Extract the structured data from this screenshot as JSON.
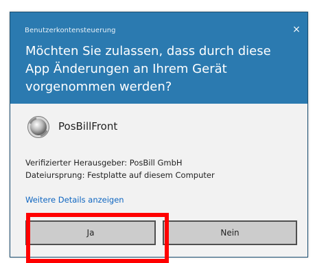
{
  "dialog": {
    "title": "Benutzerkontensteuerung",
    "close_label": "×",
    "question": "Möchten Sie zulassen, dass durch diese App Änderungen an Ihrem Gerät vorgenommen werden?",
    "app_name": "PosBillFront",
    "app_icon": "posbill-logo-icon",
    "publisher_line": "Verifizierter Herausgeber: PosBill GmbH",
    "origin_line": "Dateiursprung: Festplatte auf diesem Computer",
    "details_link": "Weitere Details anzeigen",
    "buttons": {
      "yes": "Ja",
      "no": "Nein"
    }
  },
  "colors": {
    "header_bg": "#2b7ab0",
    "body_bg": "#f2f2f2",
    "link": "#0c64c0",
    "highlight": "#ff0000"
  }
}
